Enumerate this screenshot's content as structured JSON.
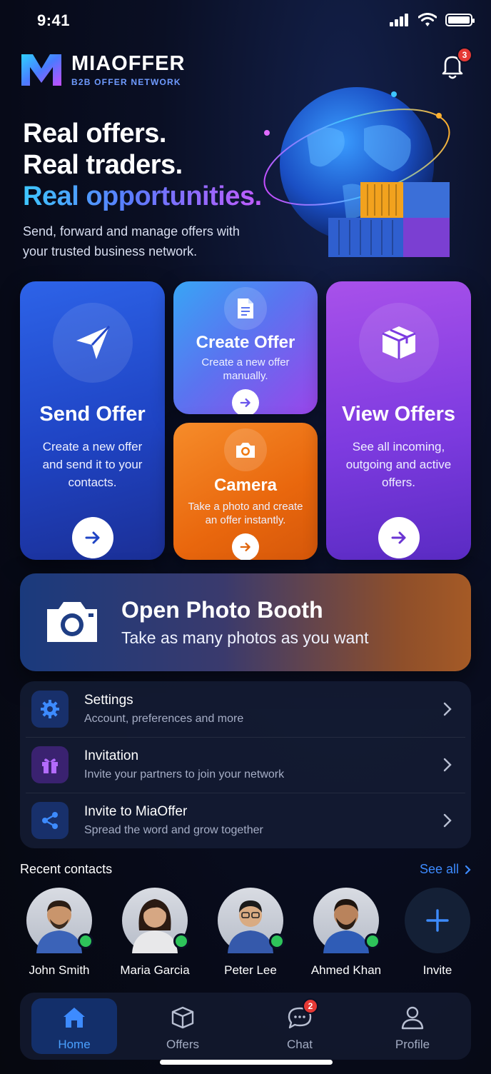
{
  "status_bar": {
    "time": "9:41"
  },
  "brand": {
    "name": "MIAOFFER",
    "tagline": "B2B OFFER NETWORK"
  },
  "notifications": {
    "count": "3"
  },
  "hero": {
    "line1": "Real offers.",
    "line2": "Real traders.",
    "line3": "Real opportunities.",
    "description": "Send, forward and manage offers with your trusted business network."
  },
  "actions": {
    "send": {
      "title": "Send Offer",
      "desc": "Create a new offer and send it to your contacts."
    },
    "create": {
      "title": "Create Offer",
      "desc": "Create a new offer manually."
    },
    "camera": {
      "title": "Camera",
      "desc": "Take a photo and create an offer instantly."
    },
    "view": {
      "title": "View Offers",
      "desc": "See all incoming, outgoing and active offers."
    }
  },
  "photo_booth": {
    "title": "Open Photo Booth",
    "subtitle": "Take as many photos as you want"
  },
  "menu": [
    {
      "title": "Settings",
      "subtitle": "Account, preferences and more"
    },
    {
      "title": "Invitation",
      "subtitle": "Invite your partners to join your network"
    },
    {
      "title": "Invite to MiaOffer",
      "subtitle": "Spread the word and grow together"
    }
  ],
  "recent_contacts": {
    "title": "Recent contacts",
    "see_all": "See all",
    "contacts": [
      {
        "name": "John Smith"
      },
      {
        "name": "Maria Garcia"
      },
      {
        "name": "Peter Lee"
      },
      {
        "name": "Ahmed Khan"
      }
    ],
    "invite_label": "Invite"
  },
  "tabs": [
    {
      "label": "Home"
    },
    {
      "label": "Offers"
    },
    {
      "label": "Chat",
      "badge": "2"
    },
    {
      "label": "Profile"
    }
  ],
  "colors": {
    "accent": "#3d8bff",
    "send_card": "#2d63e8",
    "camera_card": "#f0780f",
    "view_card": "#8a40e4",
    "online": "#2ec45a",
    "badge": "#e53935"
  }
}
